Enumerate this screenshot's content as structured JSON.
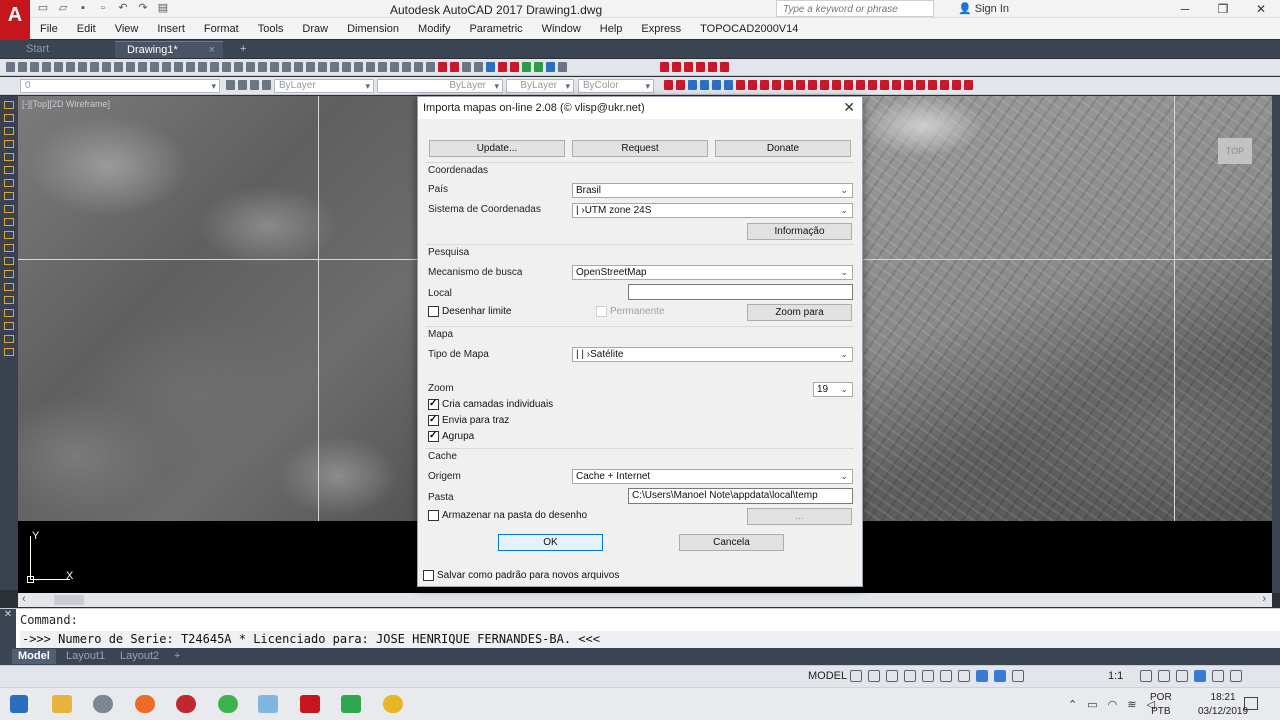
{
  "window": {
    "title": "Autodesk AutoCAD 2017    Drawing1.dwg",
    "app_logo": "A",
    "search_placeholder": "Type a keyword or phrase",
    "sign_in": "Sign In"
  },
  "menu": [
    "File",
    "Edit",
    "View",
    "Insert",
    "Format",
    "Tools",
    "Draw",
    "Dimension",
    "Modify",
    "Parametric",
    "Window",
    "Help",
    "Express",
    "TOPOCAD2000V14"
  ],
  "doc_tabs": {
    "start": "Start",
    "drawing": "Drawing1*",
    "close": "×",
    "add": "+"
  },
  "toolbar": {
    "layer_combo": "0",
    "color_combo": "ByLayer",
    "linetype_combo": "ByLayer",
    "lineweight_combo": "ByLayer",
    "plotstyle_combo": "ByColor"
  },
  "viewport": {
    "label": "[-][Top][2D Wireframe]",
    "viewcube": "TOP"
  },
  "ucs": {
    "x": "X",
    "y": "Y"
  },
  "dialog": {
    "title": "Importa mapas on-line 2.08 (© vlisp@ukr.net)",
    "buttons": {
      "update": "Update...",
      "request": "Request",
      "donate": "Donate",
      "informacao": "Informação",
      "zoom_para": "Zoom para",
      "pasta_browse": "...",
      "ok": "OK",
      "cancela": "Cancela"
    },
    "coordenadas": {
      "section": "Coordenadas",
      "pais_label": "País",
      "pais_value": "Brasil",
      "sistema_label": "Sistema de Coordenadas",
      "sistema_value": "| ›UTM zone 24S"
    },
    "pesquisa": {
      "section": "Pesquisa",
      "mecanismo_label": "Mecanismo de busca",
      "mecanismo_value": "OpenStreetMap",
      "local_label": "Local",
      "local_value": "",
      "desenhar_limite": "Desenhar limite",
      "permanente": "Permanente"
    },
    "mapa": {
      "section": "Mapa",
      "tipo_label": "Tipo de Mapa",
      "tipo_value": "| | ›Satélite",
      "zoom_label": "Zoom",
      "zoom_value": "19",
      "cria_camadas": "Cria camadas individuais",
      "envia_traz": "Envia para traz",
      "agrupa": "Agrupa"
    },
    "cache": {
      "section": "Cache",
      "origem_label": "Origem",
      "origem_value": "Cache + Internet",
      "pasta_label": "Pasta",
      "pasta_value": "C:\\Users\\Manoel Note\\appdata\\local\\temp",
      "armazenar": "Armazenar na pasta do desenho"
    },
    "salvar_padrao": "Salvar como padrão para novos arquivos",
    "checks": {
      "desenhar_limite": false,
      "permanente": false,
      "cria_camadas": true,
      "envia_traz": true,
      "agrupa": true,
      "armazenar": false,
      "salvar_padrao": false
    }
  },
  "command": {
    "line1": "Command:",
    "line2": "->>> Numero de Serie: T24645A * Licenciado para: JOSE HENRIQUE FERNANDES-BA. <<<"
  },
  "layout_tabs": [
    "Model",
    "Layout1",
    "Layout2",
    "+"
  ],
  "status": {
    "model": "MODEL",
    "scale": "1:1"
  },
  "taskbar": {
    "lang": "POR",
    "kbd": "PTB",
    "time": "18:21",
    "date": "03/12/2019"
  },
  "colors": {
    "autocad_red": "#c4161c",
    "dialog_bg": "#f0f0f0",
    "focus_blue": "#0078d7"
  }
}
